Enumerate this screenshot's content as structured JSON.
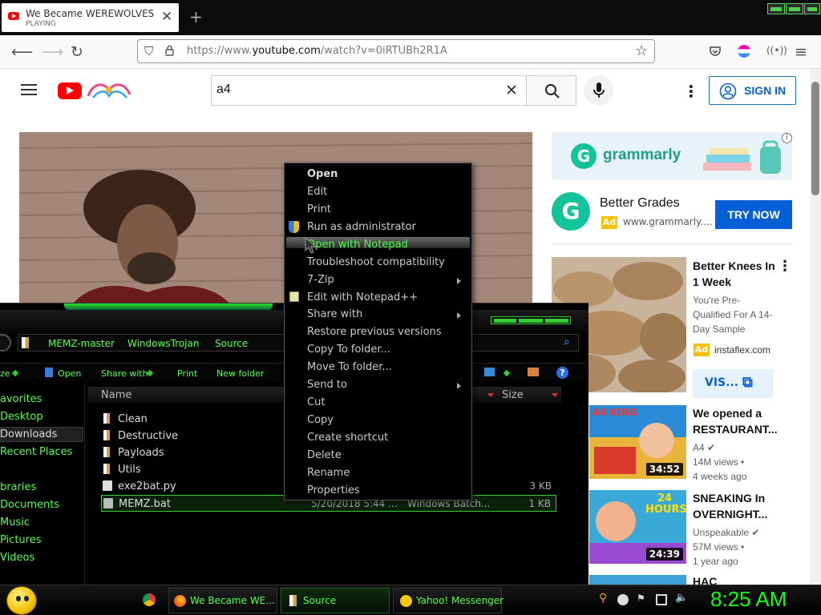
{
  "browser": {
    "tab_title": "We Became WEREWOLVES for",
    "tab_status": "PLAYING",
    "url_prefix": "https://www.",
    "url_domain": "youtube.com",
    "url_path": "/watch?v=0iRTUBh2R1A"
  },
  "youtube": {
    "search_value": "a4",
    "sign_in_label": "SIGN IN",
    "ad_banner_brand": "grammarly",
    "ad_badge": "Ad",
    "ad_title": "Better Grades",
    "ad_domain": "www.grammarly....",
    "ad_cta": "TRY NOW",
    "promo": {
      "title_line1": "Better Knees In",
      "title_line2": "1 Week",
      "desc": [
        "You're Pre-",
        "Qualified For A 14-",
        "Day Sample"
      ],
      "badge": "Ad",
      "domain": "instaflex.com",
      "cta": "VIS..."
    },
    "videos": [
      {
        "title_line1": "We opened a",
        "title_line2": "RESTAURANT...",
        "channel": "A4",
        "views": "14M views",
        "age": "4 weeks ago",
        "duration": "34:52",
        "thumb_text": "A4 KING"
      },
      {
        "title_line1": "SNEAKING In",
        "title_line2": "OVERNIGHT...",
        "channel": "Unspeakable",
        "views": "57M views",
        "age": "1 year ago",
        "duration": "24:39",
        "thumb_text": "24 HOURS"
      },
      {
        "title_line1": "HAC"
      }
    ]
  },
  "explorer": {
    "breadcrumbs": [
      "MEMZ-master",
      "WindowsTrojan",
      "Source"
    ],
    "toolbar": [
      "ze",
      "Open",
      "Share with",
      "Print",
      "New folder"
    ],
    "nav": [
      "avorites",
      "Desktop",
      "Downloads",
      "Recent Places",
      "braries",
      "Documents",
      "Music",
      "Pictures",
      "Videos"
    ],
    "columns": {
      "name": "Name",
      "size": "Size"
    },
    "files": [
      {
        "name": "Clean",
        "type": "folder",
        "date": "",
        "kind": "",
        "size": ""
      },
      {
        "name": "Destructive",
        "type": "folder",
        "date": "",
        "kind": "",
        "size": ""
      },
      {
        "name": "Payloads",
        "type": "folder",
        "date": "",
        "kind": "",
        "size": ""
      },
      {
        "name": "Utils",
        "type": "folder",
        "date": "",
        "kind": "",
        "size": ""
      },
      {
        "name": "exe2bat.py",
        "type": "file",
        "date": "",
        "kind": "",
        "size": "3 KB"
      },
      {
        "name": "MEMZ.bat",
        "type": "file",
        "date": "5/20/2018 5:44 ...",
        "kind": "Windows Batch...",
        "size": "1 KB"
      }
    ]
  },
  "context_menu": [
    "Open",
    "Edit",
    "Print",
    "Run as administrator",
    "Open with Notepad",
    "Troubleshoot compatibility",
    "7-Zip",
    "Edit with Notepad++",
    "Share with",
    "Restore previous versions",
    "Copy To folder...",
    "Move To folder...",
    "Send to",
    "Cut",
    "Copy",
    "Create shortcut",
    "Delete",
    "Rename",
    "Properties"
  ],
  "taskbar": {
    "items": [
      "We Became WE...",
      "Source",
      "Yahoo! Messenger"
    ],
    "clock": "8:25 AM"
  },
  "colors": {
    "accent_green": "#33dd33",
    "youtube_red": "#ff0000",
    "link_blue": "#065fd4"
  }
}
